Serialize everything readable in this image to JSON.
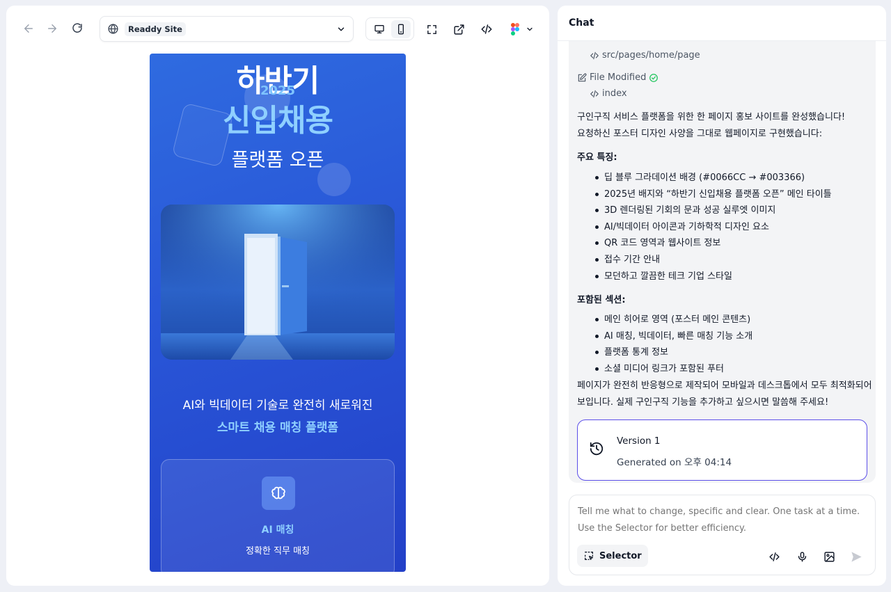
{
  "toolbar": {
    "site_label": "Readdy Site",
    "icons": [
      "arrow-left-icon",
      "arrow-right-icon",
      "refresh-icon",
      "globe-icon",
      "chevron-down-icon",
      "desktop-icon",
      "mobile-icon",
      "fullscreen-icon",
      "external-link-icon",
      "code-icon",
      "figma-icon"
    ]
  },
  "preview": {
    "title_line1": "하반기",
    "year": "2025",
    "title_line2": "신입채용",
    "subtitle": "플랫폼 오픈",
    "tagline": "AI와 빅데이터 기술로 완전히 새로워진",
    "tagline_highlight": "스마트 채용 매칭 플랫폼",
    "feature": {
      "title": "AI 매칭",
      "description": "정확한 직무 매칭"
    },
    "colors": {
      "background": "#2b5bd8",
      "accent": "#8fd0ff"
    }
  },
  "chat": {
    "header": "Chat",
    "files": [
      {
        "label": "src/pages/home/page"
      },
      {
        "label": "File Modified"
      },
      {
        "label": "index"
      }
    ],
    "intro_lines": [
      "구인구직 서비스 플랫폼을 위한 한 페이지 홍보 사이트를 완성했습니다!",
      "요청하신 포스터 디자인 사양을 그대로 웹페이지로 구현했습니다:"
    ],
    "features_heading": "주요 특징:",
    "features": [
      "딥 블루 그라데이션 배경 (#0066CC → #003366)",
      "2025년 배지와 “하반기 신입채용 플랫폼 오픈” 메인 타이틀",
      "3D 렌더링된 기회의 문과 성공 실루엣 이미지",
      "AI/빅데이터 아이콘과 기하학적 디자인 요소",
      "QR 코드 영역과 웹사이트 정보",
      "접수 기간 안내",
      "모던하고 깔끔한 테크 기업 스타일"
    ],
    "sections_heading": "포함된 섹션:",
    "sections": [
      "메인 히어로 영역 (포스터 메인 콘텐츠)",
      "AI 매칭, 빅데이터, 빠른 매칭 기능 소개",
      "플랫폼 통계 정보",
      "소셜 미디어 링크가 포함된 푸터"
    ],
    "closing_lines": [
      "페이지가 완전히 반응형으로 제작되어 모바일과 데스크톱에서 모두 최적화되어",
      "보입니다. 실제 구인구직 기능을 추가하고 싶으시면 말씀해 주세요!"
    ],
    "version": {
      "title": "Version 1",
      "subtitle": "Generated on 오후 04:14"
    },
    "input": {
      "placeholder": "Tell me what to change, specific and clear. One task at a time. Use the Selector for better efficiency.",
      "selector_label": "Selector"
    },
    "colors": {
      "version_border": "#5b4ee8",
      "check": "#22c55e"
    }
  }
}
